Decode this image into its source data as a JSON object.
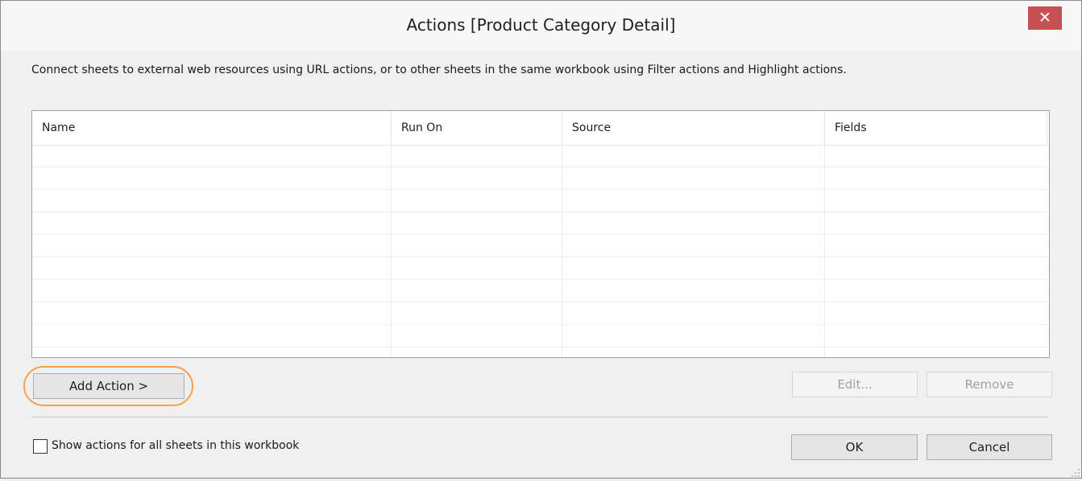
{
  "window": {
    "title": "Actions [Product Category Detail]",
    "close_glyph": "✕",
    "close_icon": "close-icon"
  },
  "description": "Connect sheets to external web resources using URL actions, or to other sheets in the same workbook using Filter actions and Highlight actions.",
  "table": {
    "columns": [
      "Name",
      "Run On",
      "Source",
      "Fields"
    ],
    "rows": []
  },
  "buttons": {
    "add_action": "Add Action >",
    "edit": "Edit...",
    "remove": "Remove",
    "ok": "OK",
    "cancel": "Cancel"
  },
  "checkbox": {
    "label": "Show actions for all sheets in this workbook",
    "checked": false
  },
  "colors": {
    "close_button": "#c75050",
    "highlight_ring": "#f5a24b"
  }
}
